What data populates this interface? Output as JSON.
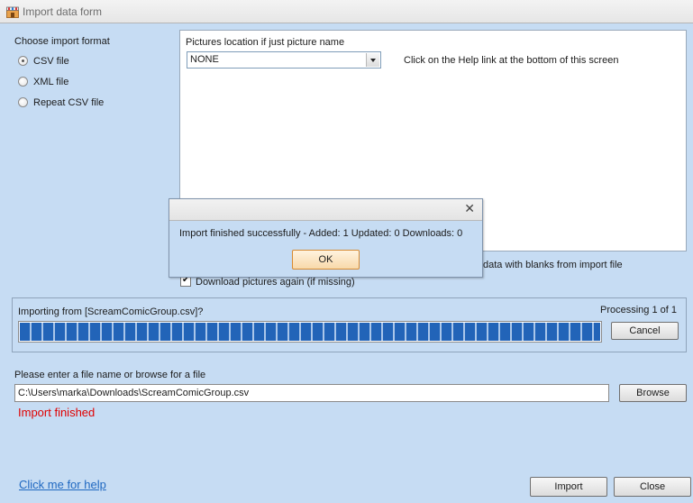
{
  "window": {
    "title": "Import data form"
  },
  "format": {
    "heading": "Choose import format",
    "options": [
      {
        "label": "CSV file",
        "checked": true
      },
      {
        "label": "XML file",
        "checked": false
      },
      {
        "label": "Repeat CSV file",
        "checked": false
      }
    ]
  },
  "pictures": {
    "location_label": "Pictures location if just picture name",
    "location_value": "NONE",
    "help_hint": "Click on the Help link at the bottom of this screen"
  },
  "options": {
    "overwrite_partial_label": "data with blanks from import file",
    "download_pictures_label": "Download pictures again (if missing)",
    "download_pictures_checked": true
  },
  "progress": {
    "importing_text": "Importing from [ScreamComicGroup.csv]?",
    "processing_text": "Processing 1 of 1",
    "percent": 100,
    "cancel_label": "Cancel"
  },
  "file": {
    "prompt": "Please enter a file name or browse for a file",
    "path": "C:\\Users\\marka\\Downloads\\ScreamComicGroup.csv",
    "browse_label": "Browse",
    "status": "Import finished"
  },
  "footer": {
    "help_link": "Click me for help",
    "import_label": "Import",
    "close_label": "Close"
  },
  "dialog": {
    "message": "Import finished successfully - Added: 1  Updated: 0  Downloads: 0",
    "ok_label": "OK",
    "close_glyph": "✕"
  }
}
